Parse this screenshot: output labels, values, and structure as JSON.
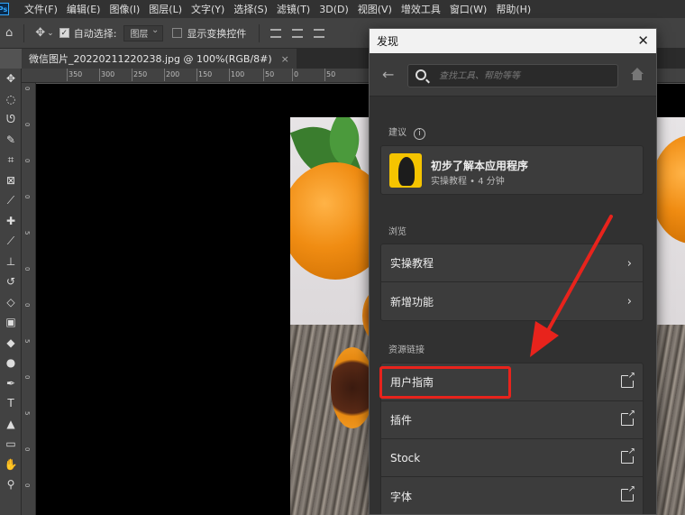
{
  "menubar": {
    "logo": "Ps",
    "items": [
      "文件(F)",
      "编辑(E)",
      "图像(I)",
      "图层(L)",
      "文字(Y)",
      "选择(S)",
      "滤镜(T)",
      "3D(D)",
      "视图(V)",
      "增效工具",
      "窗口(W)",
      "帮助(H)"
    ]
  },
  "options": {
    "auto_select_label": "自动选择:",
    "layer_select": "图层",
    "show_transform_label": "显示变换控件"
  },
  "document": {
    "tab_title": "微信图片_20220211220238.jpg @ 100%(RGB/8#)"
  },
  "ruler": {
    "h_ticks": [
      "350",
      "300",
      "250",
      "200",
      "150",
      "100",
      "50",
      "0",
      "50"
    ],
    "v_ticks": [
      "0",
      "0",
      "0",
      "0",
      "5",
      "0",
      "0",
      "5",
      "0",
      "5",
      "0",
      "0"
    ]
  },
  "panel": {
    "title": "发现",
    "search_placeholder": "查找工具、帮助等等",
    "suggestions_label": "建议",
    "suggestion": {
      "title": "初步了解本应用程序",
      "subtitle": "实操教程 • 4 分钟"
    },
    "browse_label": "浏览",
    "browse_items": [
      "实操教程",
      "新增功能"
    ],
    "resources_label": "资源链接",
    "resource_items": [
      "用户指南",
      "插件",
      "Stock",
      "字体"
    ]
  },
  "colors": {
    "highlight": "#e8231c",
    "panel_bg": "#313131"
  }
}
